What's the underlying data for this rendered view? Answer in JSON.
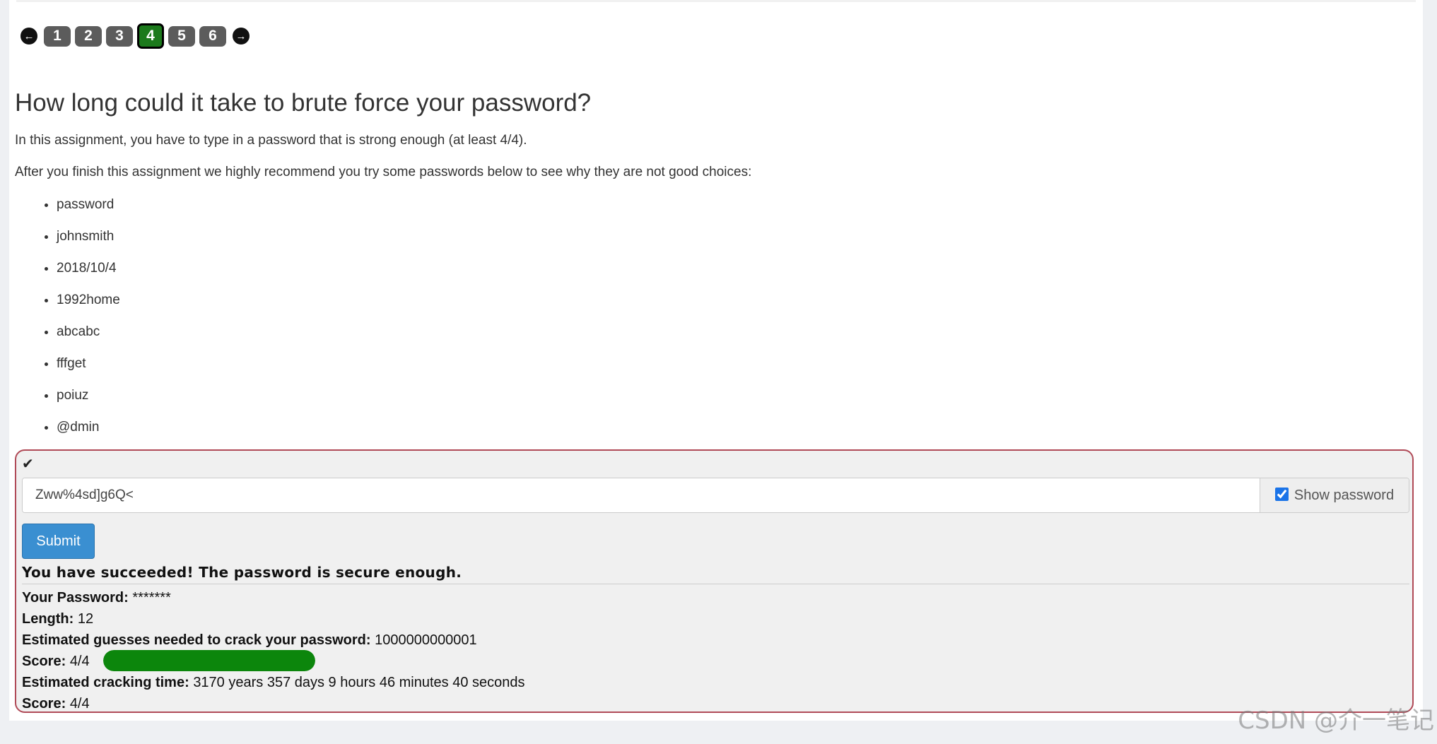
{
  "pager": {
    "pages": [
      "1",
      "2",
      "3",
      "4",
      "5",
      "6"
    ],
    "active_index": 3,
    "prev_icon": "←",
    "next_icon": "→"
  },
  "content": {
    "title": "How long could it take to brute force your password?",
    "intro": "In this assignment, you have to type in a password that is strong enough (at least 4/4).",
    "recommend": "After you finish this assignment we highly recommend you try some passwords below to see why they are not good choices:",
    "examples": [
      "password",
      "johnsmith",
      "2018/10/4",
      "1992home",
      "abcabc",
      "fffget",
      "poiuz",
      "@dmin"
    ]
  },
  "form": {
    "check_icon": "✔",
    "password_value": "Zww%4sd]g6Q<",
    "show_password_label": "Show password",
    "show_password_checked": true,
    "submit_label": "Submit"
  },
  "result": {
    "headline": "You have succeeded! The password is secure enough.",
    "password_label": "Your Password:",
    "password_value": "*******",
    "length_label": "Length:",
    "length_value": "12",
    "guesses_label": "Estimated guesses needed to crack your password:",
    "guesses_value": "1000000000001",
    "score_label": "Score:",
    "score_value": "4/4",
    "score_fraction": 1.0,
    "meter_color": "#0c860c",
    "time_label": "Estimated cracking time:",
    "time_value": "3170 years 357 days 9 hours 46 minutes 40 seconds",
    "score2_label": "Score:",
    "score2_value": "4/4"
  },
  "watermark": "CSDN @介一笔记"
}
